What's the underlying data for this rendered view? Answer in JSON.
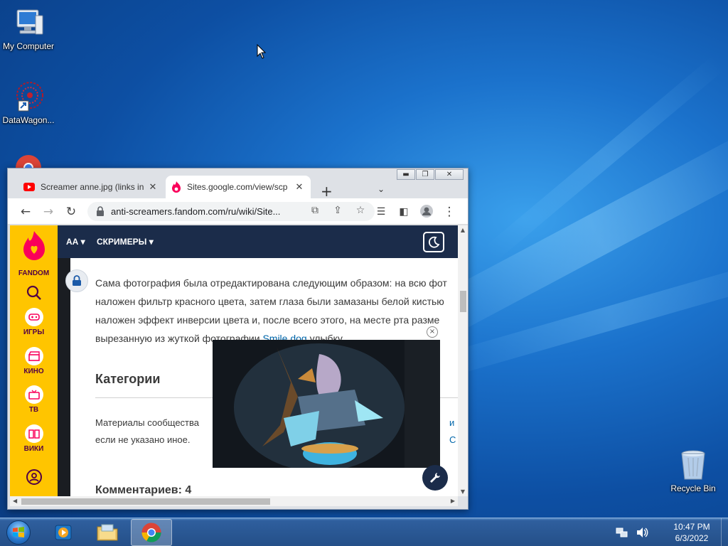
{
  "desktop": {
    "icons": [
      {
        "label": "My Computer",
        "icon": "computer-icon"
      },
      {
        "label": "DataWagon...",
        "icon": "datawagon-icon"
      },
      {
        "label": "Recycle Bin",
        "icon": "recycle-bin-icon"
      }
    ]
  },
  "browser": {
    "tabs": [
      {
        "title": "Screamer anne.jpg (links in",
        "icon": "youtube-icon"
      },
      {
        "title": "Sites.google.com/view/scp",
        "icon": "fandom-icon"
      }
    ],
    "address": "anti-screamers.fandom.com/ru/wiki/Site...",
    "toolbar_icons": [
      "back-arrow-icon",
      "forward-arrow-icon",
      "reload-icon",
      "lock-icon",
      "translate-icon",
      "share-icon",
      "star-icon",
      "media-queue-icon",
      "side-panel-icon",
      "profile-icon",
      "menu-dots-icon"
    ]
  },
  "fandom": {
    "logo_text": "FANDOM",
    "sidebar": [
      {
        "label": "",
        "icon": "search-icon"
      },
      {
        "label": "ИГРЫ",
        "icon": "gamepad-icon"
      },
      {
        "label": "КИНО",
        "icon": "clapperboard-icon"
      },
      {
        "label": "ТВ",
        "icon": "tv-icon"
      },
      {
        "label": "ВИКИ",
        "icon": "book-icon"
      },
      {
        "label": "",
        "icon": "user-icon"
      }
    ],
    "topbar": {
      "menu1": "АА",
      "menu2": "СКРИМЕРЫ"
    }
  },
  "article": {
    "lines": [
      "Сама фотография была отредактирована следующим образом: на всю фот",
      "наложен фильтр красного цвета, затем глаза были замазаны белой кистью",
      "наложен эффект инверсии цвета и, после всего этого, на месте рта разме",
      "вырезанную из жуткой фотографии"
    ],
    "link_text": "Smile.dog",
    "line4_suffix": " улыбку.",
    "categories_heading": "Категории",
    "license_line1": "Материалы сообщества",
    "license_line1_tail": "и С",
    "license_line2": "если не указано иное.",
    "comments_heading": "Комментариев: 4"
  },
  "video_close_label": "×",
  "taskbar": {
    "items": [
      "media-player-icon",
      "file-explorer-icon",
      "chrome-icon"
    ],
    "time": "10:47 PM",
    "date": "6/3/2022"
  }
}
